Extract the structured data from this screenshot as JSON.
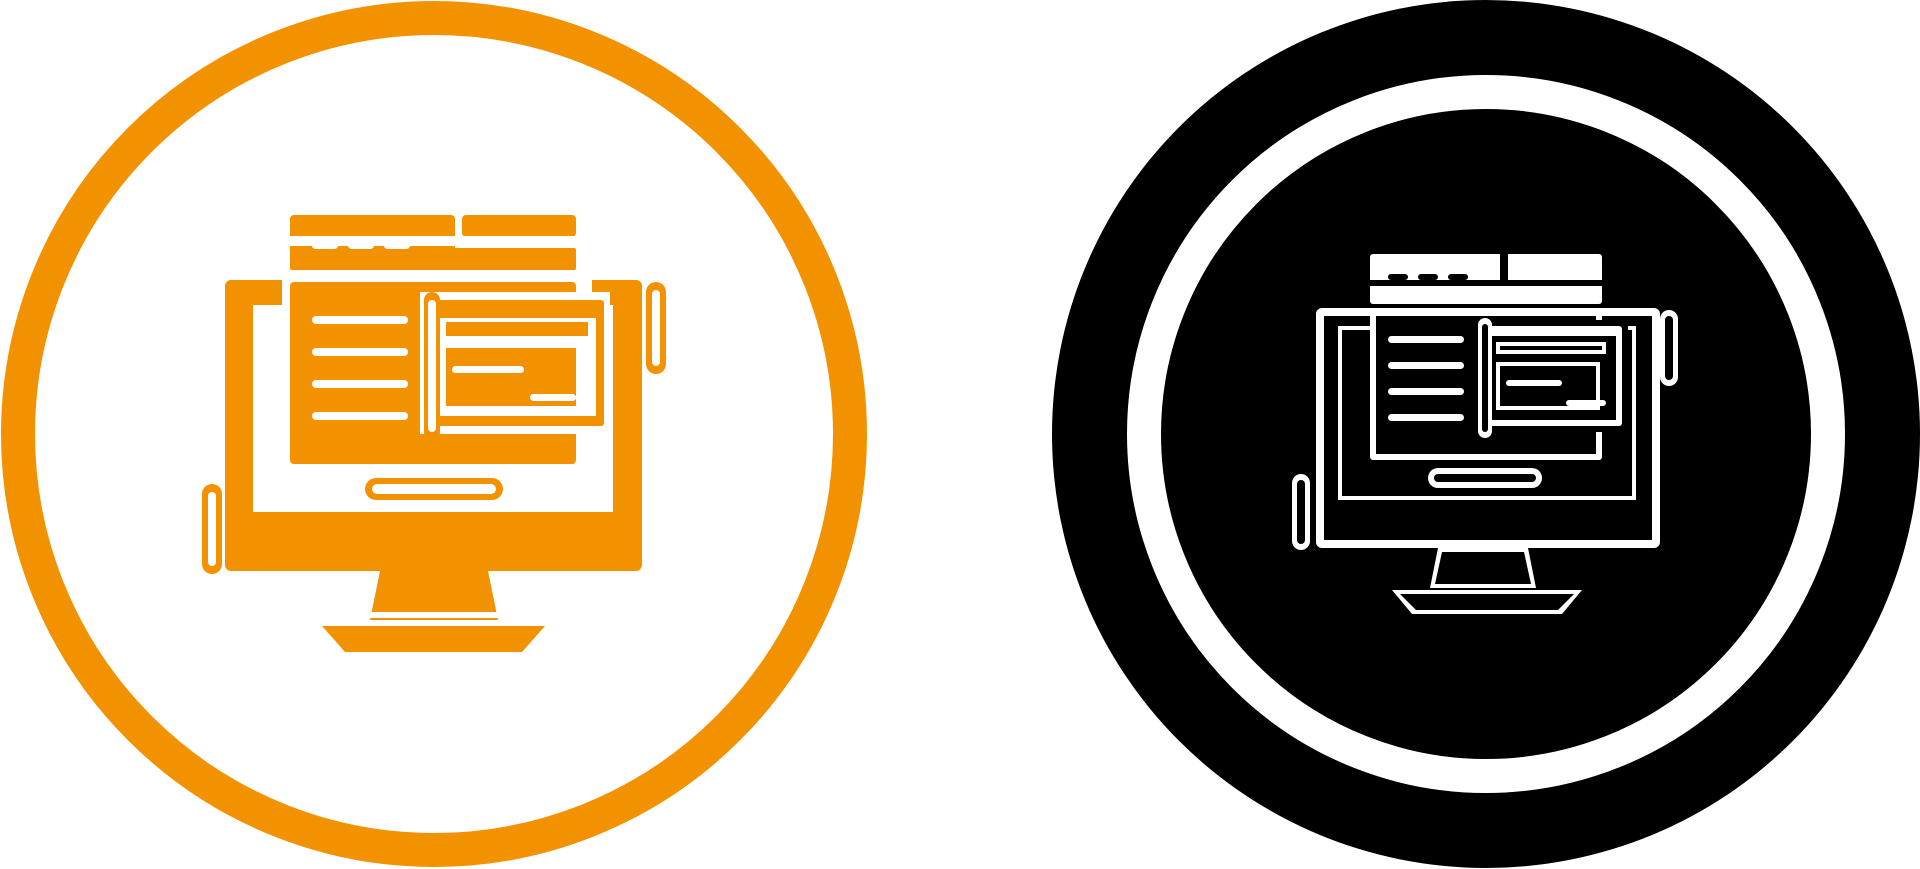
{
  "icons": [
    {
      "name": "computer-web-content-icon",
      "variant": "orange-glyph",
      "colors": {
        "primary": "#F39200",
        "background": "#FFFFFF",
        "detail": "#FFFFFF"
      }
    },
    {
      "name": "computer-web-content-icon",
      "variant": "black-glyph",
      "colors": {
        "primary": "#000000",
        "background": "#000000",
        "detail": "#FFFFFF"
      }
    }
  ]
}
